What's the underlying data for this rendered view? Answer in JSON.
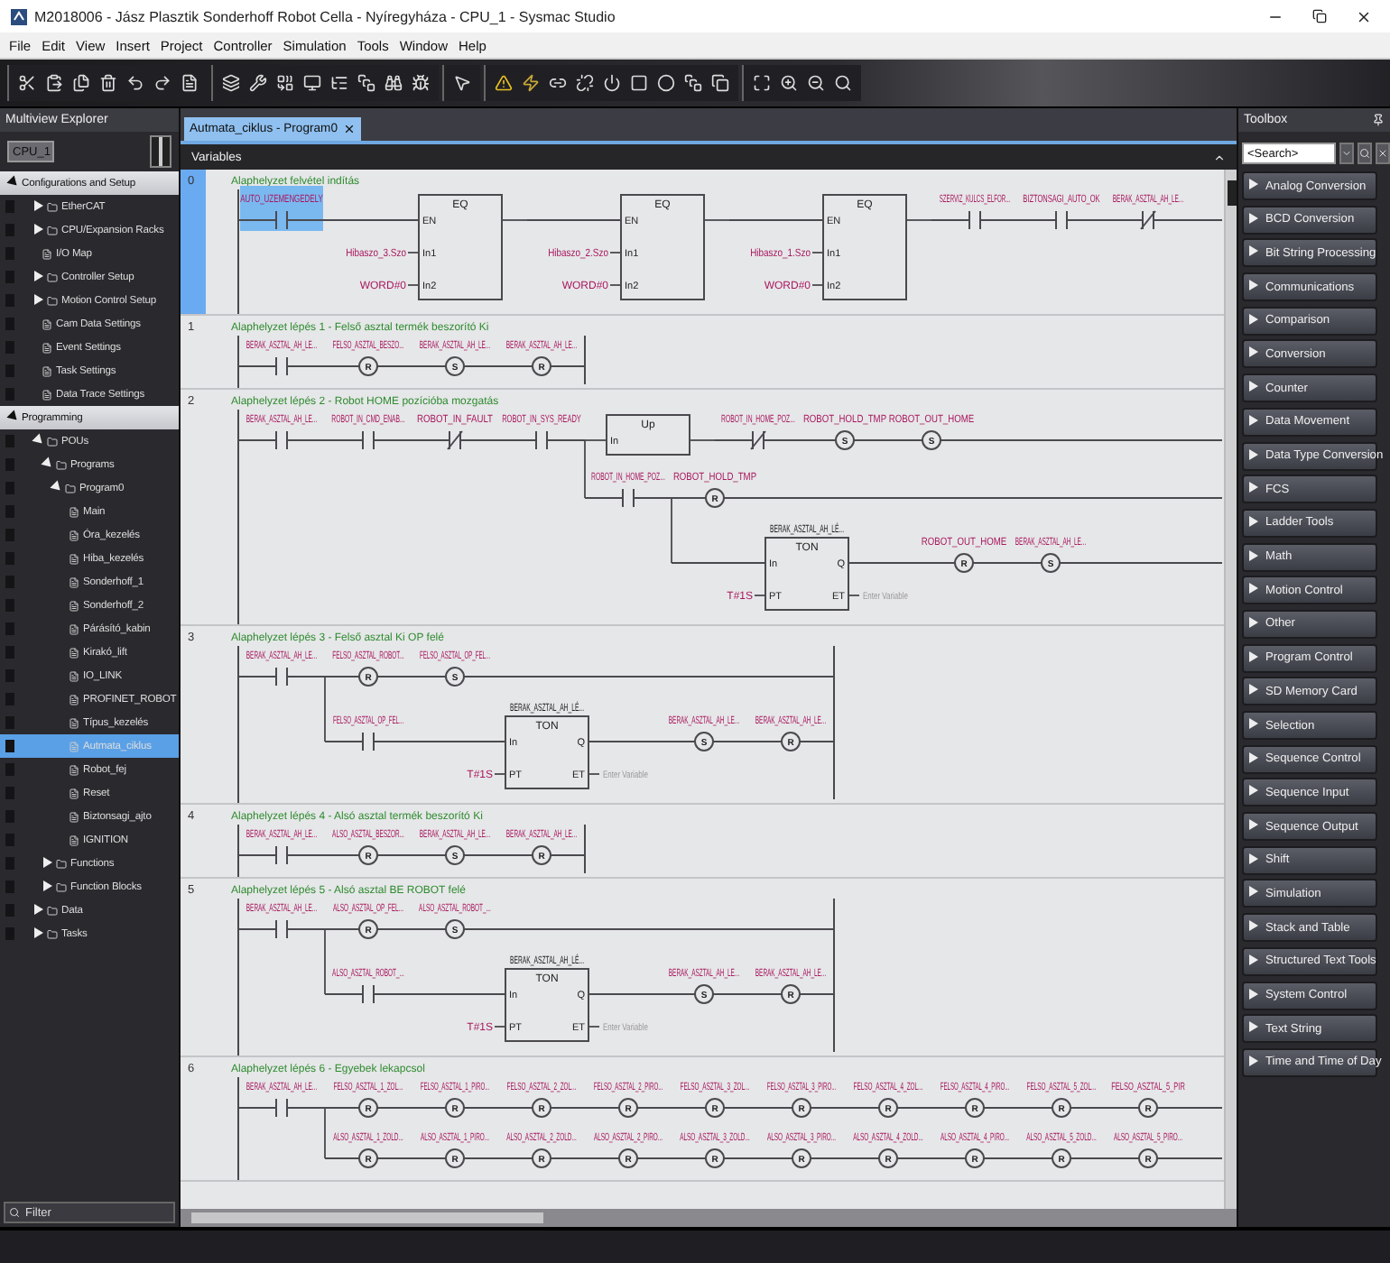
{
  "window": {
    "title": "M2018006 - Jász Plasztik Sonderhoff Robot Cella - Nyíregyháza - CPU_1 - Sysmac Studio"
  },
  "menu": [
    "File",
    "Edit",
    "View",
    "Insert",
    "Project",
    "Controller",
    "Simulation",
    "Tools",
    "Window",
    "Help"
  ],
  "explorer": {
    "title": "Multiview Explorer",
    "device": "CPU_1",
    "filter": "Filter",
    "sections": [
      {
        "label": "Configurations and Setup",
        "expanded": true,
        "selected": false,
        "children": [
          {
            "label": "EtherCAT",
            "expanded": false,
            "selected": false
          },
          {
            "label": "CPU/Expansion Racks",
            "expanded": false,
            "selected": false
          },
          {
            "label": "I/O Map",
            "selected": false
          },
          {
            "label": "Controller Setup",
            "expanded": false,
            "selected": false
          },
          {
            "label": "Motion Control Setup",
            "expanded": false,
            "selected": false
          },
          {
            "label": "Cam Data Settings",
            "selected": false
          },
          {
            "label": "Event Settings",
            "selected": false
          },
          {
            "label": "Task Settings",
            "selected": false
          },
          {
            "label": "Data Trace Settings",
            "selected": false
          }
        ]
      },
      {
        "label": "Programming",
        "expanded": true,
        "selected": false,
        "children": [
          {
            "label": "POUs",
            "expanded": true,
            "selected": false,
            "children": [
              {
                "label": "Programs",
                "expanded": true,
                "selected": false,
                "children": [
                  {
                    "label": "Program0",
                    "expanded": true,
                    "selected": false,
                    "children": [
                      {
                        "label": "Main",
                        "selected": false
                      },
                      {
                        "label": "Óra_kezelés",
                        "selected": false
                      },
                      {
                        "label": "Hiba_kezelés",
                        "selected": false
                      },
                      {
                        "label": "Sonderhoff_1",
                        "selected": false
                      },
                      {
                        "label": "Sonderhoff_2",
                        "selected": false
                      },
                      {
                        "label": "Párásító_kabin",
                        "selected": false
                      },
                      {
                        "label": "Kirakó_lift",
                        "selected": false
                      },
                      {
                        "label": "IO_LINK",
                        "selected": false
                      },
                      {
                        "label": "PROFINET_ROBOT",
                        "selected": false
                      },
                      {
                        "label": "Típus_kezelés",
                        "selected": false
                      },
                      {
                        "label": "Autmata_ciklus",
                        "selected": true
                      },
                      {
                        "label": "Robot_fej",
                        "selected": false
                      },
                      {
                        "label": "Reset",
                        "selected": false
                      },
                      {
                        "label": "Biztonsagi_ajto",
                        "selected": false
                      },
                      {
                        "label": "IGNITION",
                        "selected": false
                      }
                    ]
                  }
                ]
              },
              {
                "label": "Functions",
                "expanded": false,
                "selected": false
              },
              {
                "label": "Function Blocks",
                "expanded": false,
                "selected": false
              }
            ]
          },
          {
            "label": "Data",
            "expanded": false,
            "selected": false
          },
          {
            "label": "Tasks",
            "expanded": false,
            "selected": false
          }
        ]
      }
    ]
  },
  "editor": {
    "tab": {
      "label": "Autmata_ciklus - Program0",
      "selected": true
    },
    "variables_label": "Variables",
    "rungs": [
      {
        "number": "0",
        "selected": true,
        "continues": true,
        "comment": "Alaphelyzet felvétel indítás",
        "elements": [
          {
            "kind": "contact",
            "label": "AUTO_UZEMENGEDELY",
            "selected": true
          },
          {
            "kind": "block",
            "type": "EQ",
            "selected": false,
            "inputs": [
              {
                "pin": "EN"
              },
              {
                "pin": "In1",
                "var": "Hibaszo_3.Szo"
              },
              {
                "pin": "In2",
                "var": "WORD#0"
              }
            ]
          },
          {
            "kind": "block",
            "type": "EQ",
            "selected": false,
            "inputs": [
              {
                "pin": "EN"
              },
              {
                "pin": "In1",
                "var": "Hibaszo_2.Szo"
              },
              {
                "pin": "In2",
                "var": "WORD#0"
              }
            ]
          },
          {
            "kind": "block",
            "type": "EQ",
            "selected": false,
            "inputs": [
              {
                "pin": "EN"
              },
              {
                "pin": "In1",
                "var": "Hibaszo_1.Szo"
              },
              {
                "pin": "In2",
                "var": "WORD#0"
              }
            ]
          },
          {
            "kind": "contact",
            "label": "SZERVIZ_KULCS_ELFOR...",
            "selected": false
          },
          {
            "kind": "contact",
            "label": "BIZTONSAGI_AUTO_OK",
            "selected": false
          },
          {
            "kind": "contact_nc",
            "label": "BERAK_ASZTAL_AH_LE...",
            "selected": false
          }
        ]
      },
      {
        "number": "1",
        "selected": false,
        "continues": false,
        "comment": "Alaphelyzet lépés 1 - Felső asztal termék beszorító Ki",
        "elements": [
          {
            "kind": "contact",
            "label": "BERAK_ASZTAL_AH_LE...",
            "selected": false
          },
          {
            "kind": "coil",
            "letter": "R",
            "label": "FELSO_ASZTAL_BESZO...",
            "selected": false
          },
          {
            "kind": "coil",
            "letter": "S",
            "label": "BERAK_ASZTAL_AH_LE...",
            "selected": false
          },
          {
            "kind": "coil",
            "letter": "R",
            "label": "BERAK_ASZTAL_AH_LE...",
            "selected": false
          }
        ]
      },
      {
        "number": "2",
        "selected": false,
        "continues": true,
        "comment": "Alaphelyzet lépés 2 - Robot HOME pozícióba mozgatás",
        "elements": [
          {
            "kind": "contact",
            "label": "BERAK_ASZTAL_AH_LE...",
            "selected": false
          },
          {
            "kind": "contact",
            "label": "ROBOT_IN_CMD_ENAB...",
            "selected": false
          },
          {
            "kind": "contact_nc",
            "label": "ROBOT_IN_FAULT",
            "selected": false
          },
          {
            "kind": "contact",
            "label": "ROBOT_IN_SYS_READY",
            "selected": false,
            "branch": {
              "elements": [
                {
                  "kind": "contact",
                  "label": "ROBOT_IN_HOME_POZ...",
                  "selected": false,
                  "branch": {
                    "elements": [
                      {
                        "kind": "block",
                        "type": "TON",
                        "instance": "BERAK_ASZTAL_AH_LÉ...",
                        "selected": false,
                        "inputs": [
                          {
                            "pin": "In"
                          },
                          {
                            "pin": "PT",
                            "var": "T#1S"
                          }
                        ],
                        "outputs": [
                          {
                            "pin": "Q"
                          },
                          {
                            "pin": "ET",
                            "placeholder": "Enter Variable"
                          }
                        ]
                      },
                      {
                        "kind": "coil",
                        "letter": "R",
                        "label": "ROBOT_OUT_HOME",
                        "selected": false
                      },
                      {
                        "kind": "coil",
                        "letter": "S",
                        "label": "BERAK_ASZTAL_AH_LE...",
                        "selected": false
                      }
                    ]
                  }
                },
                {
                  "kind": "coil",
                  "letter": "R",
                  "label": "ROBOT_HOLD_TMP",
                  "selected": false
                }
              ]
            }
          },
          {
            "kind": "block",
            "type": "Up",
            "selected": false,
            "inputs": [
              {
                "pin": "In"
              }
            ]
          },
          {
            "kind": "contact_nc",
            "label": "ROBOT_IN_HOME_POZ...",
            "selected": false
          },
          {
            "kind": "coil",
            "letter": "S",
            "label": "ROBOT_HOLD_TMP",
            "selected": false
          },
          {
            "kind": "coil",
            "letter": "S",
            "label": "ROBOT_OUT_HOME",
            "selected": false
          }
        ]
      },
      {
        "number": "3",
        "selected": false,
        "continues": false,
        "comment": "Alaphelyzet lépés 3 - Felső asztal Ki OP felé",
        "elements": [
          {
            "kind": "contact",
            "label": "BERAK_ASZTAL_AH_LE...",
            "selected": false,
            "branch": {
              "elements": [
                {
                  "kind": "contact",
                  "label": "FELSO_ASZTAL_OP_FEL...",
                  "selected": false
                },
                {
                  "kind": "block",
                  "type": "TON",
                  "instance": "BERAK_ASZTAL_AH_LÉ...",
                  "selected": false,
                  "inputs": [
                    {
                      "pin": "In"
                    },
                    {
                      "pin": "PT",
                      "var": "T#1S"
                    }
                  ],
                  "outputs": [
                    {
                      "pin": "Q"
                    },
                    {
                      "pin": "ET",
                      "placeholder": "Enter Variable"
                    }
                  ]
                },
                {
                  "kind": "coil",
                  "letter": "S",
                  "label": "BERAK_ASZTAL_AH_LE...",
                  "selected": false
                },
                {
                  "kind": "coil",
                  "letter": "R",
                  "label": "BERAK_ASZTAL_AH_LE...",
                  "selected": false
                }
              ]
            }
          },
          {
            "kind": "coil",
            "letter": "R",
            "label": "FELSO_ASZTAL_ROBOT...",
            "selected": false
          },
          {
            "kind": "coil",
            "letter": "S",
            "label": "FELSO_ASZTAL_OP_FEL...",
            "selected": false
          }
        ]
      },
      {
        "number": "4",
        "selected": false,
        "continues": false,
        "comment": "Alaphelyzet lépés 4 - Alsó asztal termék beszorító Ki",
        "elements": [
          {
            "kind": "contact",
            "label": "BERAK_ASZTAL_AH_LE...",
            "selected": false
          },
          {
            "kind": "coil",
            "letter": "R",
            "label": "ALSO_ASZTAL_BESZOR...",
            "selected": false
          },
          {
            "kind": "coil",
            "letter": "S",
            "label": "BERAK_ASZTAL_AH_LE...",
            "selected": false
          },
          {
            "kind": "coil",
            "letter": "R",
            "label": "BERAK_ASZTAL_AH_LE...",
            "selected": false
          }
        ]
      },
      {
        "number": "5",
        "selected": false,
        "continues": false,
        "comment": "Alaphelyzet lépés 5 - Alsó asztal BE ROBOT felé",
        "elements": [
          {
            "kind": "contact",
            "label": "BERAK_ASZTAL_AH_LE...",
            "selected": false,
            "branch": {
              "elements": [
                {
                  "kind": "contact",
                  "label": "ALSO_ASZTAL_ROBOT_...",
                  "selected": false
                },
                {
                  "kind": "block",
                  "type": "TON",
                  "instance": "BERAK_ASZTAL_AH_LÉ...",
                  "selected": false,
                  "inputs": [
                    {
                      "pin": "In"
                    },
                    {
                      "pin": "PT",
                      "var": "T#1S"
                    }
                  ],
                  "outputs": [
                    {
                      "pin": "Q"
                    },
                    {
                      "pin": "ET",
                      "placeholder": "Enter Variable"
                    }
                  ]
                },
                {
                  "kind": "coil",
                  "letter": "S",
                  "label": "BERAK_ASZTAL_AH_LE...",
                  "selected": false
                },
                {
                  "kind": "coil",
                  "letter": "R",
                  "label": "BERAK_ASZTAL_AH_LE...",
                  "selected": false
                }
              ]
            }
          },
          {
            "kind": "coil",
            "letter": "R",
            "label": "ALSO_ASZTAL_OP_FEL...",
            "selected": false
          },
          {
            "kind": "coil",
            "letter": "S",
            "label": "ALSO_ASZTAL_ROBOT_...",
            "selected": false
          }
        ]
      },
      {
        "number": "6",
        "selected": false,
        "continues": true,
        "comment": "Alaphelyzet lépés 6 - Egyebek lekapcsol",
        "elements": [
          {
            "kind": "contact",
            "label": "BERAK_ASZTAL_AH_LE...",
            "selected": false,
            "branch": {
              "elements": [
                {
                  "kind": "coil",
                  "letter": "R",
                  "label": "ALSO_ASZTAL_1_ZOLD...",
                  "selected": false
                },
                {
                  "kind": "coil",
                  "letter": "R",
                  "label": "ALSO_ASZTAL_1_PIRO...",
                  "selected": false
                },
                {
                  "kind": "coil",
                  "letter": "R",
                  "label": "ALSO_ASZTAL_2_ZOLD...",
                  "selected": false
                },
                {
                  "kind": "coil",
                  "letter": "R",
                  "label": "ALSO_ASZTAL_2_PIRO...",
                  "selected": false
                },
                {
                  "kind": "coil",
                  "letter": "R",
                  "label": "ALSO_ASZTAL_3_ZOLD...",
                  "selected": false
                },
                {
                  "kind": "coil",
                  "letter": "R",
                  "label": "ALSO_ASZTAL_3_PIRO...",
                  "selected": false
                },
                {
                  "kind": "coil",
                  "letter": "R",
                  "label": "ALSO_ASZTAL_4_ZOLD...",
                  "selected": false
                },
                {
                  "kind": "coil",
                  "letter": "R",
                  "label": "ALSO_ASZTAL_4_PIRO...",
                  "selected": false
                },
                {
                  "kind": "coil",
                  "letter": "R",
                  "label": "ALSO_ASZTAL_5_ZOLD...",
                  "selected": false
                },
                {
                  "kind": "coil",
                  "letter": "R",
                  "label": "ALSO_ASZTAL_5_PIRO...",
                  "selected": false
                }
              ]
            }
          },
          {
            "kind": "coil",
            "letter": "R",
            "label": "FELSO_ASZTAL_1_ZOL...",
            "selected": false
          },
          {
            "kind": "coil",
            "letter": "R",
            "label": "FELSO_ASZTAL_1_PIRO...",
            "selected": false
          },
          {
            "kind": "coil",
            "letter": "R",
            "label": "FELSO_ASZTAL_2_ZOL...",
            "selected": false
          },
          {
            "kind": "coil",
            "letter": "R",
            "label": "FELSO_ASZTAL_2_PIRO...",
            "selected": false
          },
          {
            "kind": "coil",
            "letter": "R",
            "label": "FELSO_ASZTAL_3_ZOL...",
            "selected": false
          },
          {
            "kind": "coil",
            "letter": "R",
            "label": "FELSO_ASZTAL_3_PIRO...",
            "selected": false
          },
          {
            "kind": "coil",
            "letter": "R",
            "label": "FELSO_ASZTAL_4_ZOL...",
            "selected": false
          },
          {
            "kind": "coil",
            "letter": "R",
            "label": "FELSO_ASZTAL_4_PIRO...",
            "selected": false
          },
          {
            "kind": "coil",
            "letter": "R",
            "label": "FELSO_ASZTAL_5_ZOL...",
            "selected": false
          },
          {
            "kind": "coil",
            "letter": "R",
            "label": "FELSO_ASZTAL_5_PIR",
            "selected": false
          }
        ]
      }
    ]
  },
  "toolbox": {
    "title": "Toolbox",
    "search": {
      "placeholder": "<Search>"
    },
    "categories": [
      {
        "label": "Analog Conversion",
        "expanded": false
      },
      {
        "label": "BCD Conversion",
        "expanded": false
      },
      {
        "label": "Bit String Processing",
        "expanded": false
      },
      {
        "label": "Communications",
        "expanded": false
      },
      {
        "label": "Comparison",
        "expanded": false
      },
      {
        "label": "Conversion",
        "expanded": false
      },
      {
        "label": "Counter",
        "expanded": false
      },
      {
        "label": "Data Movement",
        "expanded": false
      },
      {
        "label": "Data Type Conversion",
        "expanded": false
      },
      {
        "label": "FCS",
        "expanded": false
      },
      {
        "label": "Ladder Tools",
        "expanded": false
      },
      {
        "label": "Math",
        "expanded": false
      },
      {
        "label": "Motion Control",
        "expanded": false
      },
      {
        "label": "Other",
        "expanded": false
      },
      {
        "label": "Program Control",
        "expanded": false
      },
      {
        "label": "SD Memory Card",
        "expanded": false
      },
      {
        "label": "Selection",
        "expanded": false
      },
      {
        "label": "Sequence Control",
        "expanded": false
      },
      {
        "label": "Sequence Input",
        "expanded": false
      },
      {
        "label": "Sequence Output",
        "expanded": false
      },
      {
        "label": "Shift",
        "expanded": false
      },
      {
        "label": "Simulation",
        "expanded": false
      },
      {
        "label": "Stack and Table",
        "expanded": false
      },
      {
        "label": "Structured Text Tools",
        "expanded": false
      },
      {
        "label": "System Control",
        "expanded": false
      },
      {
        "label": "Text String",
        "expanded": false
      },
      {
        "label": "Time and Time of Day",
        "expanded": false
      }
    ]
  }
}
